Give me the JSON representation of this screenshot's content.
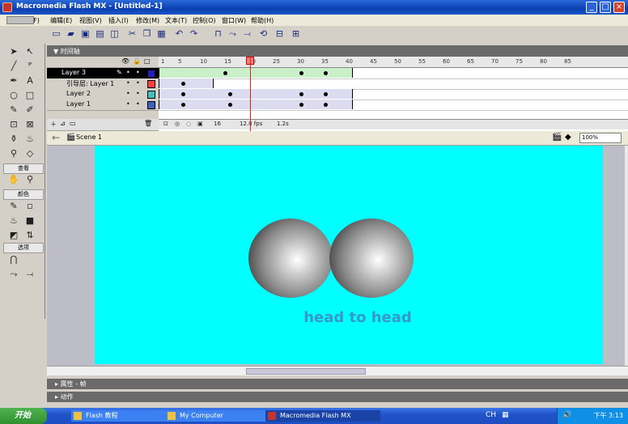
{
  "window": {
    "title": "Macromedia Flash MX - [Untitled-1]",
    "minimize": "_",
    "maximize": "□",
    "close": "×"
  },
  "menubar": {
    "items": [
      "文件(F)",
      "编辑(E)",
      "视图(V)",
      "插入(I)",
      "修改(M)",
      "文本(T)",
      "控制(O)",
      "窗口(W)",
      "帮助(H)"
    ]
  },
  "toolbar": {
    "icons": [
      "new-file-icon",
      "open-folder-icon",
      "save-icon",
      "print-icon",
      "print-preview-icon",
      "cut-icon",
      "copy-icon",
      "paste-icon",
      "undo-icon",
      "redo-icon",
      "snap-icon",
      "smooth-icon",
      "straighten-icon",
      "rotate-icon",
      "scale-icon",
      "align-icon"
    ]
  },
  "tools": {
    "section_view": "查看",
    "section_colors": "颜色",
    "section_options": "选项"
  },
  "timeline": {
    "panel_title": "▼ 时间轴",
    "layers": [
      {
        "name": "Layer 3",
        "color": "#2020c0",
        "selected": true
      },
      {
        "name": "引导层: Layer 1",
        "color": "#ff4040",
        "selected": false
      },
      {
        "name": "Layer 2",
        "color": "#40c0c0",
        "selected": false
      },
      {
        "name": "Layer 1",
        "color": "#4060c0",
        "selected": false
      }
    ],
    "ruler_ticks": [
      "1",
      "5",
      "10",
      "15",
      "20",
      "25",
      "30",
      "35",
      "40",
      "45",
      "50",
      "55",
      "60",
      "65",
      "70",
      "75",
      "80",
      "85"
    ],
    "status": {
      "current_frame": "16",
      "fps": "12.0 fps",
      "elapsed": "1.2s"
    }
  },
  "scene": {
    "name": "Scene 1",
    "zoom": "100%"
  },
  "stage": {
    "background": "#00ffff",
    "text": "head to head",
    "text_color": "#3399cc"
  },
  "panels": {
    "properties": "▸ 属性 - 帧",
    "actions": "▸ 动作"
  },
  "taskbar": {
    "start": "开始",
    "tasks": [
      "Flash 教程",
      "My Computer",
      "Macromedia Flash MX"
    ],
    "time": "下午 3:13"
  }
}
